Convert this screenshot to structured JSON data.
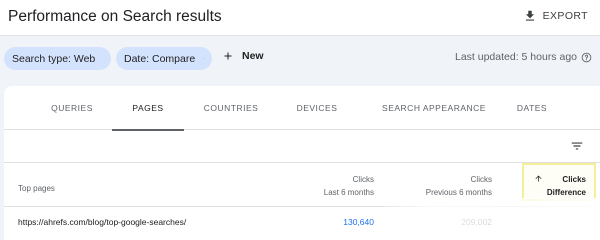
{
  "header": {
    "title": "Performance on Search results",
    "export_label": "EXPORT"
  },
  "filters": {
    "chips": [
      {
        "label": "Search type: Web",
        "icon": "pencil-icon"
      },
      {
        "label": "Date: Compare",
        "icon": "pencil-icon"
      }
    ],
    "new_label": "New",
    "last_updated": "Last updated: 5 hours ago"
  },
  "tabs": [
    {
      "label": "QUERIES",
      "active": false
    },
    {
      "label": "PAGES",
      "active": true
    },
    {
      "label": "COUNTRIES",
      "active": false
    },
    {
      "label": "DEVICES",
      "active": false
    },
    {
      "label": "SEARCH APPEARANCE",
      "active": false
    },
    {
      "label": "DATES",
      "active": false
    }
  ],
  "table": {
    "columns": {
      "page": "Top pages",
      "clicks_current": {
        "metric": "Clicks",
        "period": "Last 6 months"
      },
      "clicks_previous": {
        "metric": "Clicks",
        "period": "Previous 6 months"
      },
      "clicks_difference": {
        "metric": "Clicks",
        "period": "Difference",
        "sorted": "ascending"
      }
    },
    "rows": [
      {
        "page": "https://ahrefs.com/blog/top-google-searches/",
        "clicks_current": "130,640",
        "clicks_previous": "209,002"
      }
    ]
  },
  "colors": {
    "accent": "#1a73e8",
    "chip_bg": "#d3e3fd",
    "highlight_border": "#f4ef9a",
    "page_bg": "#f0f4f9"
  }
}
